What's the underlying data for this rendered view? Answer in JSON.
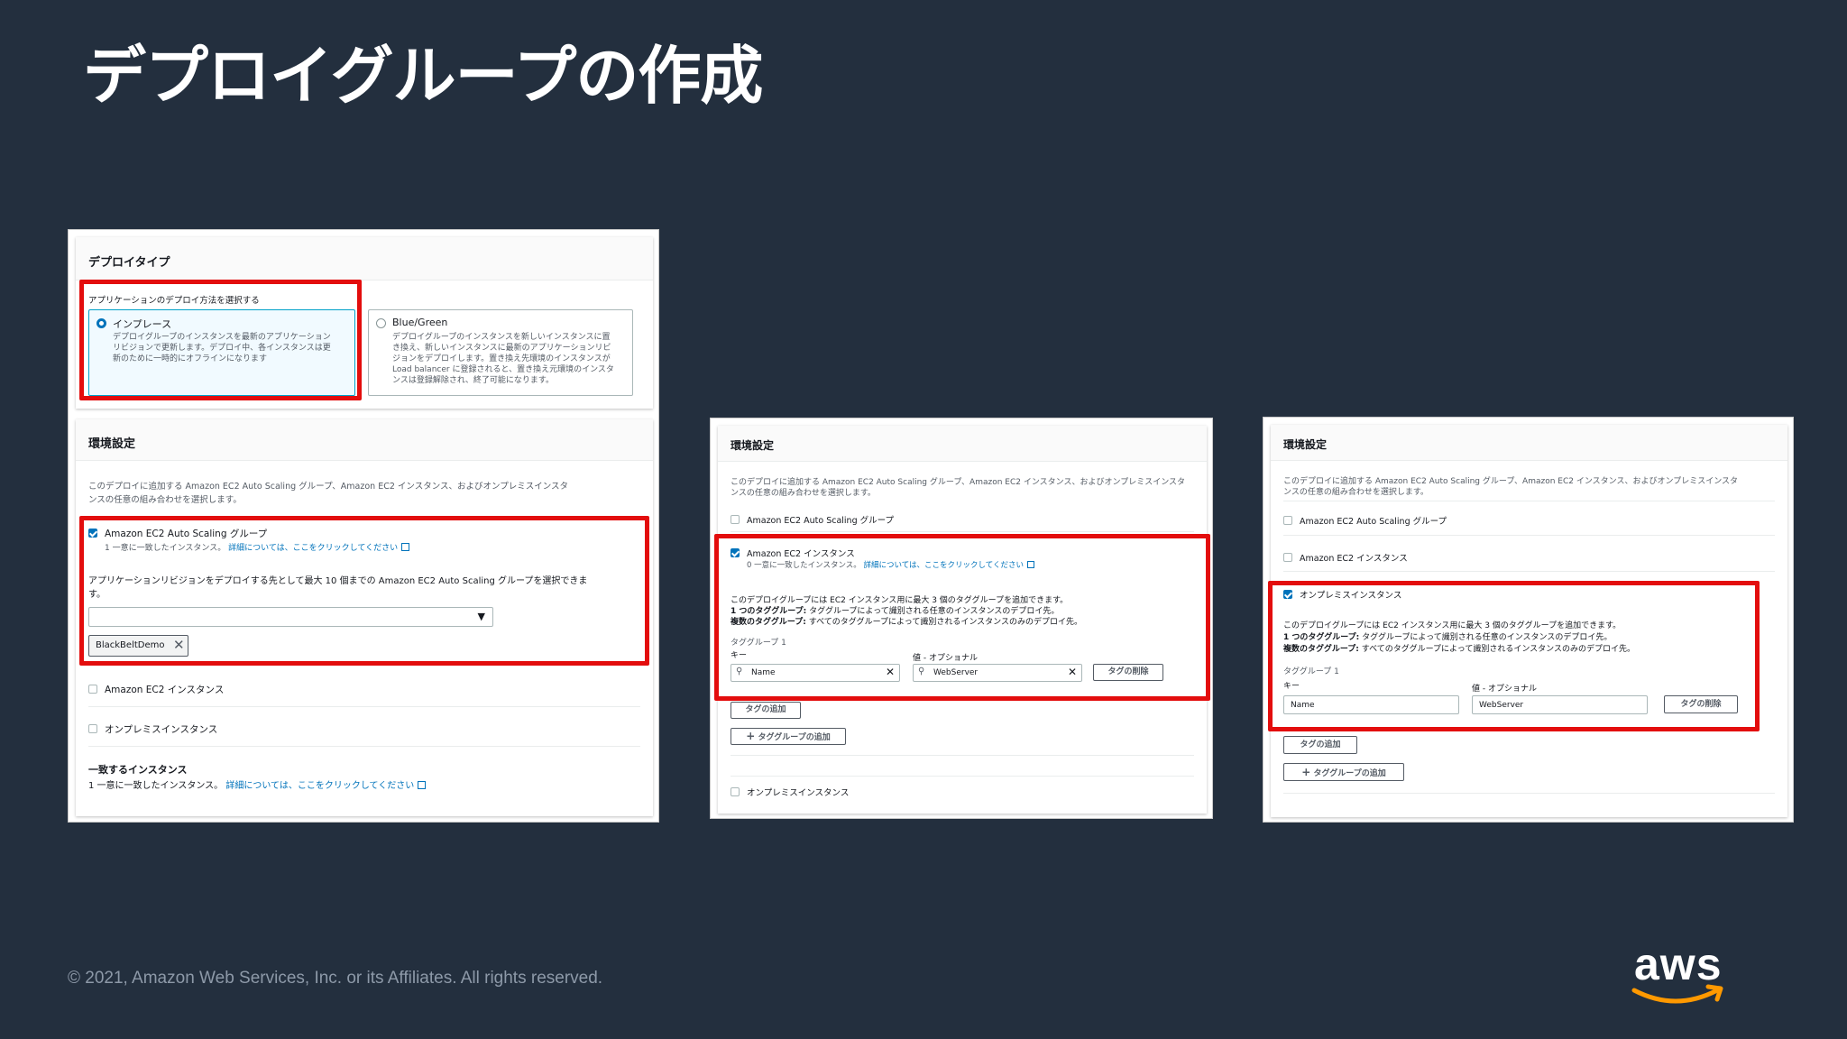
{
  "slide": {
    "title": "デプロイグループの作成",
    "footer": "© 2021, Amazon Web Services, Inc. or its Affiliates. All rights reserved.",
    "logo_text": "aws",
    "colors": {
      "background": "#232f3e",
      "highlight": "#e30d0d",
      "link": "#0073bb",
      "aws_smile": "#ff9900"
    }
  },
  "panel1": {
    "deploy_type": {
      "title": "デプロイタイプ",
      "prompt": "アプリケーションのデプロイ方法を選択する",
      "inplace": {
        "label": "インプレース",
        "desc1": "デプロイグループのインスタンスを最新のアプリケーション",
        "desc2": "リビジョンで更新します。デプロイ中、各インスタンスは更",
        "desc3": "新のために一時的にオフラインになります"
      },
      "bluegreen": {
        "label": "Blue/Green",
        "desc1": "デプロイグループのインスタンスを新しいインスタンスに置",
        "desc2": "き換え、新しいインスタンスに最新のアプリケーションリビ",
        "desc3": "ジョンをデプロイします。置き換え先環境のインスタンスが",
        "desc4": "Load balancer に登録されると、置き換え元環境のインスタ",
        "desc5": "ンスは登録解除され、終了可能になります。"
      }
    },
    "env": {
      "title": "環境設定",
      "desc1": "このデプロイに追加する Amazon EC2 Auto Scaling グループ、Amazon EC2 インスタンス、およびオンプレミスインスタ",
      "desc2": "ンスの任意の組み合わせを選択します。",
      "asg_label": "Amazon EC2 Auto Scaling グループ",
      "asg_match": "1 一意に一致したインスタンス。",
      "asg_link": "詳細については、ここをクリックしてください",
      "asg_select_prompt1": "アプリケーションリビジョンをデプロイする先として最大 10 個までの Amazon EC2 Auto Scaling グループを選択できま",
      "asg_select_prompt2": "す。",
      "token": "BlackBeltDemo",
      "ec2_label": "Amazon EC2 インスタンス",
      "onprem_label": "オンプレミスインスタンス",
      "matching_title": "一致するインスタンス",
      "matching_text": "1 一意に一致したインスタンス。",
      "matching_link": "詳細については、ここをクリックしてください"
    }
  },
  "panel2": {
    "title": "環境設定",
    "desc1": "このデプロイに追加する Amazon EC2 Auto Scaling グループ、Amazon EC2 インスタンス、およびオンプレミスインスタ",
    "desc2": "ンスの任意の組み合わせを選択します。",
    "asg_label": "Amazon EC2 Auto Scaling グループ",
    "ec2_label": "Amazon EC2 インスタンス",
    "ec2_match": "0 一意に一致したインスタンス。",
    "ec2_link": "詳細については、ここをクリックしてください",
    "info1": "このデプロイグループには EC2 インスタンス用に最大 3 個のタググループを追加できます。",
    "info2_bold": "1 つのタググループ:",
    "info2": " タググループによって識別される任意のインスタンスのデプロイ先。",
    "info3_bold": "複数のタググループ:",
    "info3": " すべてのタググループによって識別されるインスタンスのみのデプロイ先。",
    "tag_group": "タググループ 1",
    "key_label": "キー",
    "value_label": "値 - オプショナル",
    "key_value": "Name",
    "value_value": "WebServer",
    "remove_tag": "タグの削除",
    "add_tag": "タグの追加",
    "add_tag_group": "タググループの追加",
    "onprem_label": "オンプレミスインスタンス"
  },
  "panel3": {
    "title": "環境設定",
    "desc1": "このデプロイに追加する Amazon EC2 Auto Scaling グループ、Amazon EC2 インスタンス、およびオンプレミスインスタ",
    "desc2": "ンスの任意の組み合わせを選択します。",
    "asg_label": "Amazon EC2 Auto Scaling グループ",
    "ec2_label": "Amazon EC2 インスタンス",
    "onprem_label": "オンプレミスインスタンス",
    "info1": "このデプロイグループには EC2 インスタンス用に最大 3 個のタググループを追加できます。",
    "info2_bold": "1 つのタググループ:",
    "info2": " タググループによって識別される任意のインスタンスのデプロイ先。",
    "info3_bold": "複数のタググループ:",
    "info3": " すべてのタググループによって識別されるインスタンスのみのデプロイ先。",
    "tag_group": "タググループ 1",
    "key_label": "キー",
    "value_label": "値 - オプショナル",
    "key_value": "Name",
    "value_value": "WebServer",
    "remove_tag": "タグの削除",
    "add_tag": "タグの追加",
    "add_tag_group": "タググループの追加"
  }
}
